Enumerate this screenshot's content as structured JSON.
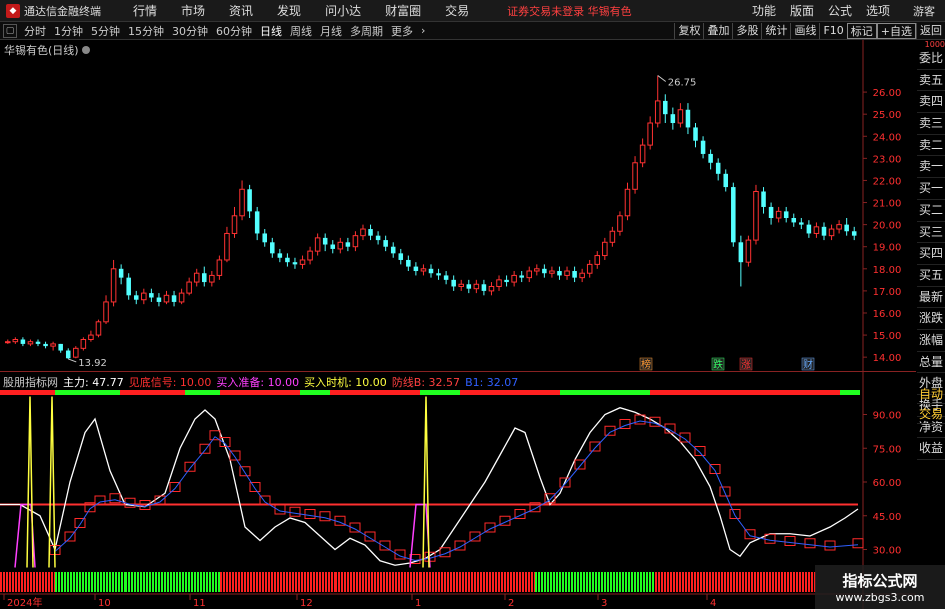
{
  "app": {
    "logo_text": "通达信金融终端"
  },
  "menu": {
    "items": [
      "行情",
      "市场",
      "资讯",
      "发现",
      "问小达",
      "财富圈",
      "交易"
    ],
    "notice": "证券交易未登录  华锡有色",
    "right": [
      "功能",
      "版面",
      "公式",
      "选项"
    ],
    "guest": "游客"
  },
  "toolbar": {
    "periods": [
      "分时",
      "1分钟",
      "5分钟",
      "15分钟",
      "30分钟",
      "60分钟",
      "日线",
      "周线",
      "月线",
      "多周期",
      "更多"
    ],
    "active": "日线",
    "right": [
      "复权",
      "叠加",
      "多股",
      "统计",
      "画线",
      "F10",
      "标记",
      "+自选",
      "返回"
    ]
  },
  "stock": {
    "title": "华锡有色(日线)"
  },
  "main_chart": {
    "yticks": [
      "26.00",
      "25.00",
      "24.00",
      "23.00",
      "22.00",
      "21.00",
      "20.00",
      "19.00",
      "18.00",
      "17.00",
      "16.00",
      "15.00",
      "14.00"
    ],
    "high_label": "26.75",
    "low_label": "13.92",
    "markers": [
      {
        "text": "榜",
        "color": "#ff9933"
      },
      {
        "text": "跌",
        "color": "#33ff66"
      },
      {
        "text": "涨",
        "color": "#ff3333"
      },
      {
        "text": "财",
        "color": "#66aaff"
      }
    ]
  },
  "indicator": {
    "name": "股朋指标网",
    "values": [
      {
        "text": "主力: 47.77",
        "color": "#ffffff"
      },
      {
        "text": "见底信号: 10.00",
        "color": "#ff3030"
      },
      {
        "text": "买入准备: 10.00",
        "color": "#ff40ff"
      },
      {
        "text": "买入时机: 10.00",
        "color": "#ffff40"
      },
      {
        "text": "防线B: 32.57",
        "color": "#ff4040"
      },
      {
        "text": "B1: 32.07",
        "color": "#3060ff"
      }
    ],
    "yticks": [
      "90.00",
      "75.00",
      "60.00",
      "45.00",
      "30.00"
    ]
  },
  "x_axis": {
    "labels": [
      "2024年",
      "10",
      "11",
      "12",
      "1",
      "2",
      "3",
      "4"
    ]
  },
  "sidebar": {
    "top_label": "1000",
    "items": [
      "委比",
      "卖五",
      "卖四",
      "卖三",
      "卖二",
      "卖一",
      "买一",
      "买二",
      "买三",
      "买四",
      "买五",
      "最新",
      "涨跌",
      "涨幅",
      "总量",
      "外盘",
      "换手",
      "净资",
      "收益"
    ],
    "bottom_items": [
      "自动",
      "交易"
    ]
  },
  "watermark": {
    "line1": "指标公式网",
    "line2": "www.zbgs3.com"
  },
  "colors": {
    "up": "#ff3232",
    "down": "#54ffff",
    "bg": "#000000"
  },
  "chart_data": {
    "type": "candlestick",
    "ylim": [
      13.6,
      27.0
    ],
    "candles": [
      [
        14.7,
        14.7,
        14.8,
        14.6
      ],
      [
        14.7,
        14.8,
        14.9,
        14.6
      ],
      [
        14.8,
        14.6,
        14.9,
        14.5
      ],
      [
        14.6,
        14.7,
        14.8,
        14.5
      ],
      [
        14.7,
        14.6,
        14.8,
        14.5
      ],
      [
        14.6,
        14.5,
        14.7,
        14.4
      ],
      [
        14.5,
        14.6,
        14.7,
        14.3
      ],
      [
        14.6,
        14.3,
        14.6,
        14.2
      ],
      [
        14.3,
        13.95,
        14.4,
        13.92
      ],
      [
        14.0,
        14.4,
        14.5,
        13.95
      ],
      [
        14.4,
        14.8,
        14.9,
        14.3
      ],
      [
        14.8,
        15.0,
        15.2,
        14.7
      ],
      [
        15.0,
        15.6,
        15.7,
        14.9
      ],
      [
        15.6,
        16.5,
        16.8,
        15.5
      ],
      [
        16.5,
        18.0,
        18.4,
        16.3
      ],
      [
        18.0,
        17.6,
        18.2,
        17.3
      ],
      [
        17.6,
        16.8,
        17.8,
        16.6
      ],
      [
        16.8,
        16.6,
        17.0,
        16.4
      ],
      [
        16.6,
        16.9,
        17.1,
        16.4
      ],
      [
        16.9,
        16.7,
        17.1,
        16.5
      ],
      [
        16.7,
        16.5,
        16.9,
        16.3
      ],
      [
        16.5,
        16.8,
        17.0,
        16.4
      ],
      [
        16.8,
        16.5,
        17.0,
        16.3
      ],
      [
        16.5,
        16.9,
        17.1,
        16.4
      ],
      [
        16.9,
        17.4,
        17.6,
        16.8
      ],
      [
        17.4,
        17.8,
        18.0,
        17.2
      ],
      [
        17.8,
        17.4,
        18.1,
        17.2
      ],
      [
        17.4,
        17.7,
        17.9,
        17.2
      ],
      [
        17.7,
        18.4,
        18.6,
        17.5
      ],
      [
        18.4,
        19.6,
        19.9,
        18.3
      ],
      [
        19.6,
        20.4,
        20.8,
        19.4
      ],
      [
        20.4,
        21.6,
        22.0,
        20.2
      ],
      [
        21.6,
        20.6,
        21.8,
        20.3
      ],
      [
        20.6,
        19.6,
        20.8,
        19.3
      ],
      [
        19.6,
        19.2,
        19.8,
        19.0
      ],
      [
        19.2,
        18.7,
        19.4,
        18.5
      ],
      [
        18.7,
        18.5,
        18.9,
        18.3
      ],
      [
        18.5,
        18.3,
        18.7,
        18.1
      ],
      [
        18.3,
        18.2,
        18.5,
        18.0
      ],
      [
        18.2,
        18.4,
        18.6,
        18.0
      ],
      [
        18.4,
        18.8,
        19.0,
        18.2
      ],
      [
        18.8,
        19.4,
        19.6,
        18.6
      ],
      [
        19.4,
        19.1,
        19.6,
        18.8
      ],
      [
        19.1,
        18.9,
        19.3,
        18.7
      ],
      [
        18.9,
        19.2,
        19.4,
        18.7
      ],
      [
        19.2,
        19.0,
        19.4,
        18.8
      ],
      [
        19.0,
        19.5,
        19.7,
        18.8
      ],
      [
        19.5,
        19.8,
        20.0,
        19.3
      ],
      [
        19.8,
        19.5,
        20.0,
        19.3
      ],
      [
        19.5,
        19.3,
        19.7,
        19.1
      ],
      [
        19.3,
        19.0,
        19.5,
        18.8
      ],
      [
        19.0,
        18.7,
        19.2,
        18.5
      ],
      [
        18.7,
        18.4,
        18.9,
        18.2
      ],
      [
        18.4,
        18.1,
        18.6,
        17.9
      ],
      [
        18.1,
        17.9,
        18.3,
        17.7
      ],
      [
        17.9,
        18.0,
        18.2,
        17.7
      ],
      [
        18.0,
        17.8,
        18.2,
        17.6
      ],
      [
        17.8,
        17.7,
        18.0,
        17.5
      ],
      [
        17.7,
        17.5,
        17.9,
        17.3
      ],
      [
        17.5,
        17.2,
        17.7,
        17.0
      ],
      [
        17.2,
        17.3,
        17.5,
        17.0
      ],
      [
        17.3,
        17.1,
        17.5,
        16.9
      ],
      [
        17.1,
        17.3,
        17.5,
        16.9
      ],
      [
        17.3,
        17.0,
        17.5,
        16.8
      ],
      [
        17.0,
        17.2,
        17.4,
        16.8
      ],
      [
        17.2,
        17.5,
        17.7,
        17.0
      ],
      [
        17.5,
        17.4,
        17.7,
        17.2
      ],
      [
        17.4,
        17.7,
        17.9,
        17.2
      ],
      [
        17.7,
        17.6,
        17.9,
        17.4
      ],
      [
        17.6,
        17.9,
        18.1,
        17.4
      ],
      [
        17.9,
        18.0,
        18.2,
        17.7
      ],
      [
        18.0,
        17.8,
        18.2,
        17.6
      ],
      [
        17.8,
        17.9,
        18.1,
        17.6
      ],
      [
        17.9,
        17.7,
        18.1,
        17.5
      ],
      [
        17.7,
        17.9,
        18.1,
        17.5
      ],
      [
        17.9,
        17.6,
        18.1,
        17.4
      ],
      [
        17.6,
        17.8,
        18.0,
        17.4
      ],
      [
        17.8,
        18.2,
        18.4,
        17.6
      ],
      [
        18.2,
        18.6,
        18.8,
        18.0
      ],
      [
        18.6,
        19.2,
        19.4,
        18.4
      ],
      [
        19.2,
        19.7,
        19.9,
        19.0
      ],
      [
        19.7,
        20.4,
        20.6,
        19.5
      ],
      [
        20.4,
        21.6,
        21.9,
        20.2
      ],
      [
        21.6,
        22.8,
        23.1,
        21.4
      ],
      [
        22.8,
        23.6,
        23.9,
        22.6
      ],
      [
        23.6,
        24.6,
        24.9,
        23.4
      ],
      [
        24.6,
        25.6,
        26.75,
        24.4
      ],
      [
        25.6,
        25.0,
        25.9,
        24.6
      ],
      [
        25.0,
        24.6,
        25.3,
        24.3
      ],
      [
        24.6,
        25.2,
        25.5,
        24.4
      ],
      [
        25.2,
        24.4,
        25.5,
        24.1
      ],
      [
        24.4,
        23.8,
        24.6,
        23.5
      ],
      [
        23.8,
        23.2,
        24.0,
        23.0
      ],
      [
        23.2,
        22.8,
        23.4,
        22.5
      ],
      [
        22.8,
        22.3,
        23.0,
        22.0
      ],
      [
        22.3,
        21.7,
        22.5,
        21.5
      ],
      [
        21.7,
        19.2,
        21.9,
        19.0
      ],
      [
        19.2,
        18.3,
        19.5,
        17.2
      ],
      [
        18.3,
        19.3,
        19.5,
        18.1
      ],
      [
        19.3,
        21.5,
        21.8,
        19.1
      ],
      [
        21.5,
        20.8,
        21.7,
        20.5
      ],
      [
        20.8,
        20.3,
        21.0,
        20.0
      ],
      [
        20.3,
        20.6,
        20.8,
        20.1
      ],
      [
        20.6,
        20.3,
        20.8,
        20.1
      ],
      [
        20.3,
        20.1,
        20.5,
        19.9
      ],
      [
        20.1,
        20.0,
        20.3,
        19.8
      ],
      [
        20.0,
        19.6,
        20.2,
        19.4
      ],
      [
        19.6,
        19.9,
        20.1,
        19.4
      ],
      [
        19.9,
        19.5,
        20.1,
        19.3
      ],
      [
        19.5,
        19.8,
        20.0,
        19.3
      ],
      [
        19.8,
        20.0,
        20.2,
        19.6
      ],
      [
        20.0,
        19.7,
        20.3,
        19.5
      ],
      [
        19.7,
        19.5,
        19.9,
        19.3
      ]
    ]
  }
}
